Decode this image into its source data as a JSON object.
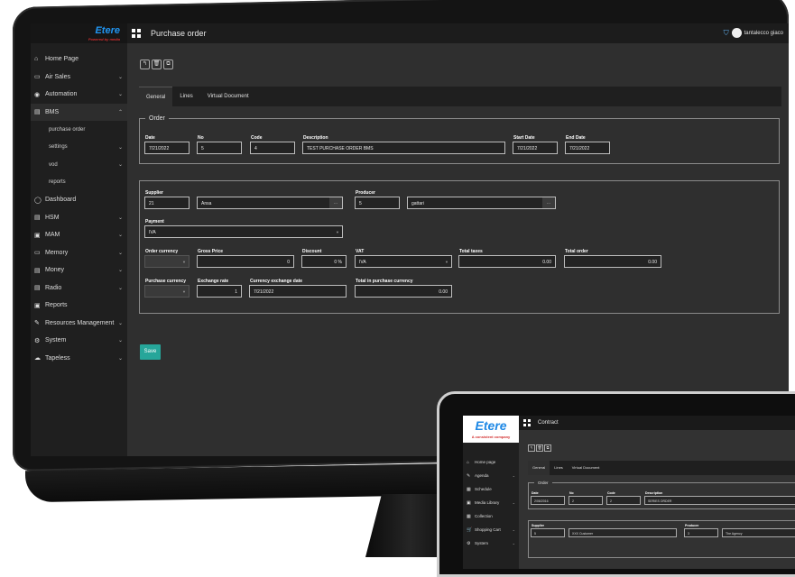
{
  "desktop": {
    "logo": {
      "text": "Etere",
      "tagline": "Powered by media"
    },
    "page_title": "Purchase order",
    "user_name": "tantalecco giaco",
    "nav": [
      {
        "icon": "home-icon",
        "glyph": "⌂",
        "label": "Home Page",
        "chevron": ""
      },
      {
        "icon": "air-sales-icon",
        "glyph": "▭",
        "label": "Air Sales",
        "chevron": "⌄"
      },
      {
        "icon": "automation-icon",
        "glyph": "◉",
        "label": "Automation",
        "chevron": "⌄"
      },
      {
        "icon": "bms-icon",
        "glyph": "▤",
        "label": "BMS",
        "chevron": "⌃"
      },
      {
        "icon": "dashboard-icon",
        "glyph": "◯",
        "label": "Dashboard",
        "chevron": ""
      },
      {
        "icon": "hsm-icon",
        "glyph": "▤",
        "label": "HSM",
        "chevron": "⌄"
      },
      {
        "icon": "mam-icon",
        "glyph": "▣",
        "label": "MAM",
        "chevron": "⌄"
      },
      {
        "icon": "memory-icon",
        "glyph": "▭",
        "label": "Memory",
        "chevron": "⌄"
      },
      {
        "icon": "money-icon",
        "glyph": "▤",
        "label": "Money",
        "chevron": "⌄"
      },
      {
        "icon": "radio-icon",
        "glyph": "▤",
        "label": "Radio",
        "chevron": "⌄"
      },
      {
        "icon": "reports-icon",
        "glyph": "▣",
        "label": "Reports",
        "chevron": ""
      },
      {
        "icon": "resources-icon",
        "glyph": "✎",
        "label": "Resources Management",
        "chevron": "⌄"
      },
      {
        "icon": "system-icon",
        "glyph": "⚙",
        "label": "System",
        "chevron": "⌄"
      },
      {
        "icon": "tapeless-icon",
        "glyph": "☁",
        "label": "Tapeless",
        "chevron": "⌄"
      }
    ],
    "bms_subitems": [
      {
        "label": "purchase order",
        "chevron": ""
      },
      {
        "label": "settings",
        "chevron": "⌄"
      },
      {
        "label": "vod",
        "chevron": "⌄"
      },
      {
        "label": "reports",
        "chevron": ""
      }
    ],
    "toolbar": {
      "back": "↰",
      "delete": "🗑",
      "copy": "⧉"
    },
    "tabs": [
      "General",
      "Lines",
      "Virtual Document"
    ],
    "order": {
      "legend": "Order",
      "date_label": "Date",
      "date": "7/21/2022",
      "no_label": "No",
      "no": "5",
      "code_label": "Code",
      "code": "4",
      "desc_label": "Description",
      "desc": "TEST PURCHASE ORDER BMS",
      "start_label": "Start Date",
      "start": "7/21/2022",
      "end_label": "End Date",
      "end": "7/21/2022"
    },
    "details": {
      "supplier_label": "Supplier",
      "supplier_code": "21",
      "supplier_name": "Ansa",
      "producer_label": "Producer",
      "producer_code": "5",
      "producer_name": "gattari",
      "payment_label": "Payment",
      "payment": "IVA",
      "order_currency_label": "Order currency",
      "order_currency": "",
      "gross_price_label": "Gross Price",
      "gross_price": "0",
      "discount_label": "Discount",
      "discount": "0 %",
      "vat_label": "VAT",
      "vat": "IVA",
      "total_taxes_label": "Total taxes",
      "total_taxes": "0.00",
      "total_order_label": "Total order",
      "total_order": "0.00",
      "purchase_currency_label": "Purchase currency",
      "purchase_currency": "",
      "exchange_rate_label": "Exchange rate",
      "exchange_rate": "1",
      "currency_exchange_date_label": "Currency exchange date",
      "currency_exchange_date": "7/21/2022",
      "total_purchase_label": "Total in purchase currency",
      "total_purchase": "0.00",
      "ellipsis": "..."
    },
    "save_label": "Save"
  },
  "tablet": {
    "logo": {
      "text": "Etere",
      "tagline": "A consistent company"
    },
    "page_title": "Contract",
    "nav": [
      {
        "icon": "home-icon",
        "glyph": "⌂",
        "label": "Home page",
        "chevron": ""
      },
      {
        "icon": "agenda-icon",
        "glyph": "✎",
        "label": "Agenda",
        "chevron": "⌄"
      },
      {
        "icon": "schedule-icon",
        "glyph": "▦",
        "label": "Schedule",
        "chevron": ""
      },
      {
        "icon": "media-library-icon",
        "glyph": "▣",
        "label": "Media Library",
        "chevron": "⌄"
      },
      {
        "icon": "collection-icon",
        "glyph": "▦",
        "label": "Collection",
        "chevron": ""
      },
      {
        "icon": "shopping-cart-icon",
        "glyph": "🛒",
        "label": "Shopping Cart",
        "chevron": "⌄"
      },
      {
        "icon": "system-icon",
        "glyph": "⚙",
        "label": "System",
        "chevron": "⌄"
      }
    ],
    "tabs": [
      "General",
      "Lines",
      "Virtual Document"
    ],
    "order": {
      "legend": "Order",
      "date_label": "Date",
      "date": "2/06/2016",
      "no_label": "No",
      "no": "2",
      "code_label": "Code",
      "code": "2",
      "desc_label": "Description",
      "desc": "SERIES ORDER"
    },
    "supplier_label": "Supplier",
    "supplier_code": "5",
    "supplier_name": "XXX Customer",
    "producer_label": "Producer",
    "producer_code": "3",
    "producer_name": "The Agency"
  }
}
